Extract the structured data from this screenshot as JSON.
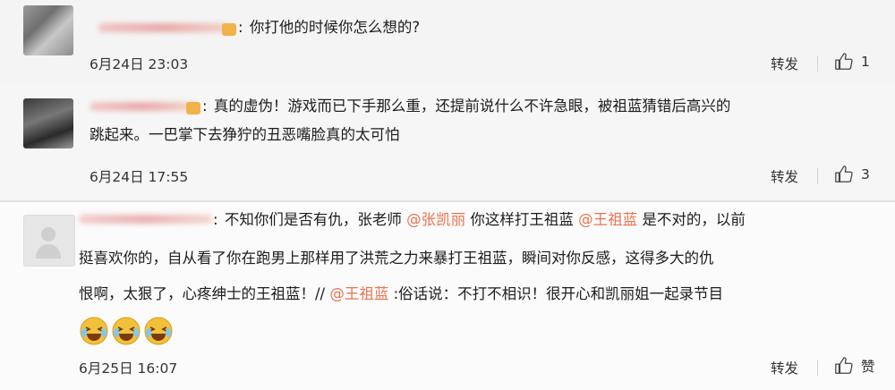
{
  "comments": [
    {
      "text_lines": [
        "你打他的时候你怎么想的?"
      ],
      "time": "6月24日 23:03",
      "forward_label": "转发",
      "like_count": "1"
    },
    {
      "text_lines": [
        "真的虚伪！游戏而已下手那么重，还提前说什么不许急眼，被祖蓝猜错后高兴的",
        "跳起来。一巴掌下去狰狞的丑恶嘴脸真的太可怕"
      ],
      "time": "6月24日 17:55",
      "forward_label": "转发",
      "like_count": "3"
    },
    {
      "line1_a": "不知你们是否有仇，张老师",
      "mention1": "@张凯丽",
      "line1_b": " 你这样打王祖蓝",
      "mention2": "@王祖蓝",
      "line1_c": " 是不对的，以前",
      "line2": "挺喜欢你的，自从看了你在跑男上那样用了洪荒之力来暴打王祖蓝，瞬间对你反感，这得多大的仇",
      "line3_a": "恨啊，太狠了，心疼绅士的王祖蓝！//",
      "mention3": "@王祖蓝",
      "line3_b": ":俗话说：不打不相识！很开心和凯丽姐一起录节目",
      "time": "6月25日 16:07",
      "forward_label": "转发",
      "like_label": "赞"
    }
  ],
  "colon": ":",
  "icons": {
    "like": "thumbs-up-icon",
    "badge": "member-badge-icon",
    "emoji": "laughing-crying-emoji"
  },
  "colors": {
    "mention": "#eb7350",
    "badge": "#f0b24a",
    "emoji": "#f2c13a"
  }
}
